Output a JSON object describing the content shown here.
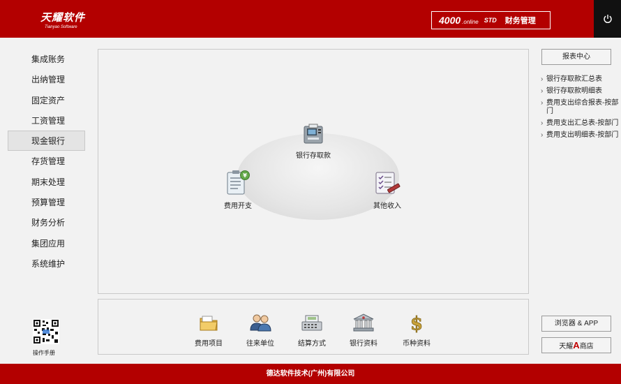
{
  "header": {
    "logo_main": "天耀软件",
    "logo_sub": "Tianyao Software",
    "product_number": "4000",
    "product_online": ".online",
    "product_edition": "STD",
    "product_name": "财务管理"
  },
  "sidebar": {
    "items": [
      {
        "label": "集成账务"
      },
      {
        "label": "出纳管理"
      },
      {
        "label": "固定资产"
      },
      {
        "label": "工资管理"
      },
      {
        "label": "现金银行"
      },
      {
        "label": "存货管理"
      },
      {
        "label": "期末处理"
      },
      {
        "label": "预算管理"
      },
      {
        "label": "财务分析"
      },
      {
        "label": "集团应用"
      },
      {
        "label": "系统维护"
      }
    ],
    "active_index": 4,
    "manual_label": "操作手册"
  },
  "flow": {
    "bank": "银行存取款",
    "expense": "费用开支",
    "income": "其他收入"
  },
  "toolbar": {
    "items": [
      {
        "label": "费用项目",
        "icon": "folder-icon"
      },
      {
        "label": "往来单位",
        "icon": "people-icon"
      },
      {
        "label": "结算方式",
        "icon": "cash-register-icon"
      },
      {
        "label": "银行资料",
        "icon": "bank-building-icon"
      },
      {
        "label": "币种资料",
        "icon": "dollar-icon"
      }
    ]
  },
  "right_panel": {
    "report_center": "报表中心",
    "reports": [
      "银行存取款汇总表",
      "银行存取款明细表",
      "费用支出综合报表-按部门",
      "费用支出汇总表-按部门",
      "费用支出明细表-按部门"
    ],
    "browser_app": "浏览器 & APP",
    "store_prefix": "天耀",
    "store_letter": "A",
    "store_suffix": "商店"
  },
  "footer": {
    "company": "德达软件技术(广州)有限公司"
  },
  "colors": {
    "brand_red": "#b30000",
    "power_bg": "#111111"
  }
}
